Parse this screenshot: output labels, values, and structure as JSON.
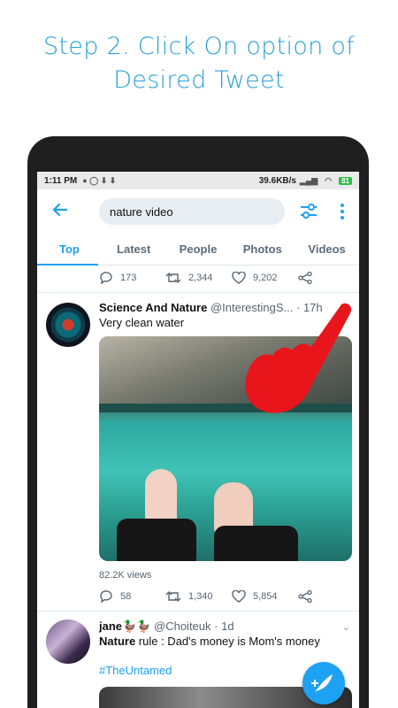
{
  "headline": "Step 2. Click On option of Desired Tweet",
  "status_bar": {
    "time": "1:11 PM",
    "net_speed": "39.6KB/s",
    "battery": "81",
    "colors": {
      "battery": "#2fbf4a"
    }
  },
  "toolbar": {
    "search_value": "nature video",
    "back_icon": "arrow-left-icon",
    "filter_icon": "sliders-icon",
    "more_icon": "vertical-dots-icon"
  },
  "tabs": [
    {
      "label": "Top",
      "active": true
    },
    {
      "label": "Latest",
      "active": false
    },
    {
      "label": "People",
      "active": false
    },
    {
      "label": "Photos",
      "active": false
    },
    {
      "label": "Videos",
      "active": false
    }
  ],
  "prev_tweet_actions": {
    "replies": "173",
    "retweets": "2,344",
    "likes": "9,202"
  },
  "tweet1": {
    "author": "Science And Nature",
    "handle": "@InterestingS...",
    "time": "· 17h",
    "text": "Very clean water",
    "views": "82.2K views",
    "replies": "58",
    "retweets": "1,340",
    "likes": "5,854"
  },
  "tweet2": {
    "author": "jane🦆🦆",
    "handle": "@Choiteuk",
    "time": "· 1d",
    "text_bold": "Nature",
    "text_rest": " rule : Dad's money is Mom's money",
    "hashtag": "#TheUntamed"
  },
  "colors": {
    "accent": "#1da1f2",
    "headline": "#2a9fd8",
    "pointer_hand": "#e8151b"
  }
}
